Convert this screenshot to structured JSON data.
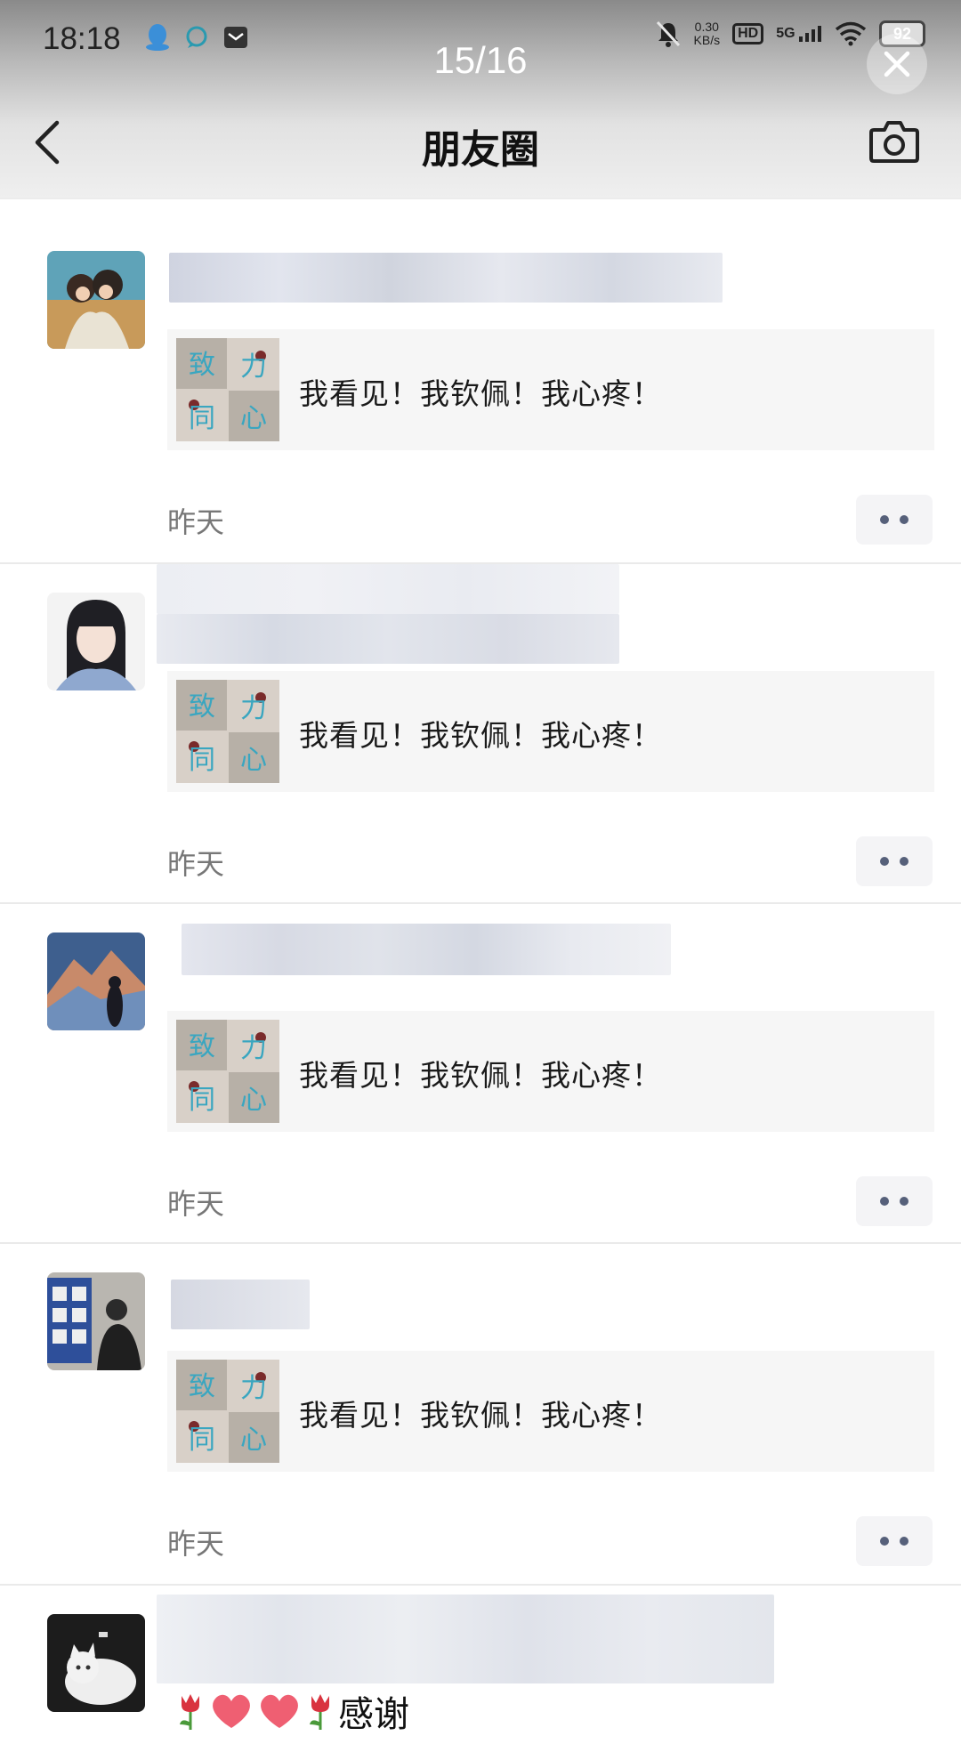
{
  "status_bar": {
    "time": "18:18",
    "net_speed_top": "0.30",
    "net_speed_bottom": "KB/s",
    "hd": "HD",
    "signal": "5G",
    "battery": "92",
    "icons": [
      "qq-icon",
      "chat-bubble-icon",
      "mail-icon",
      "mute-bell-icon",
      "wifi-icon"
    ]
  },
  "viewer": {
    "counter": "15/16"
  },
  "nav": {
    "title": "朋友圈"
  },
  "feed": {
    "posts": [
      {
        "quote": "我看见！我钦佩！我心疼！",
        "time": "昨天",
        "avatar": "couple-illustration"
      },
      {
        "quote": "我看见！我钦佩！我心疼！",
        "time": "昨天",
        "avatar": "girl-illustration"
      },
      {
        "quote": "我看见！我钦佩！我心疼！",
        "time": "昨天",
        "avatar": "mountain-silhouette"
      },
      {
        "quote": "我看见！我钦佩！我心疼！",
        "time": "昨天",
        "avatar": "person-photo"
      },
      {
        "text": "感谢",
        "avatar": "white-cat"
      }
    ],
    "thumb_chars": [
      "致",
      "力",
      "同",
      "心"
    ]
  },
  "colors": {
    "quote_bg": "#f6f6f6",
    "dots": "#56607a",
    "time": "#777777"
  }
}
